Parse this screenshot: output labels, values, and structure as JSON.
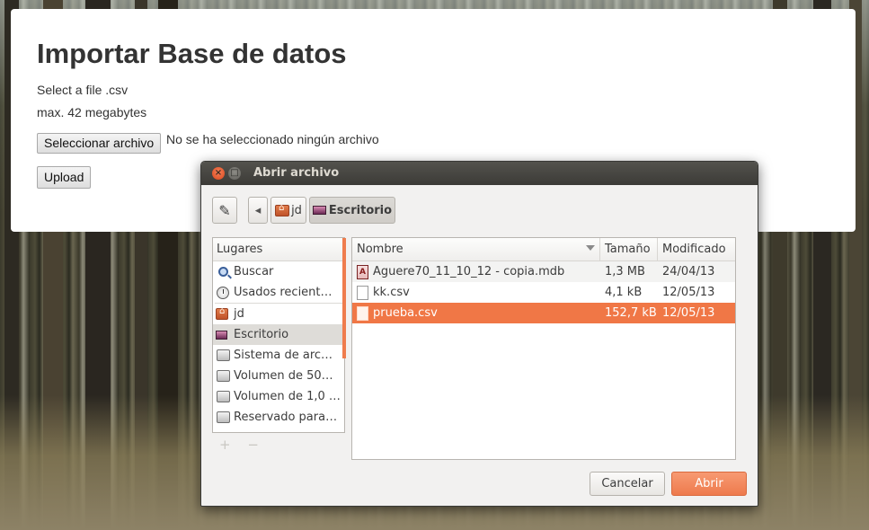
{
  "page": {
    "title": "Importar Base de datos",
    "select_text": "Select a file .csv",
    "max_text": "max. 42 megabytes",
    "choose_file_button": "Seleccionar archivo",
    "no_file_text": "No se ha seleccionado ningún archivo",
    "upload_button": "Upload"
  },
  "dialog": {
    "title": "Abrir archivo",
    "close_symbol": "×",
    "maximize_symbol": "□",
    "edit_icon_glyph": "✎",
    "back_glyph": "◂",
    "breadcrumbs": [
      {
        "label": "jd",
        "icon": "home-folder-icon"
      },
      {
        "label": "Escritorio",
        "icon": "desktop-icon",
        "active": true
      }
    ],
    "places": {
      "header": "Lugares",
      "items": [
        {
          "label": "Buscar",
          "icon": "search-icon"
        },
        {
          "label": "Usados recient…",
          "icon": "recent-icon"
        },
        {
          "label": "jd",
          "icon": "home-folder-icon"
        },
        {
          "label": "Escritorio",
          "icon": "desktop-icon",
          "selected": true
        },
        {
          "label": "Sistema de arc…",
          "icon": "drive-icon"
        },
        {
          "label": "Volumen de 50…",
          "icon": "drive-icon"
        },
        {
          "label": "Volumen de 1,0 …",
          "icon": "drive-icon"
        },
        {
          "label": "Reservado para…",
          "icon": "drive-icon"
        }
      ],
      "add_symbol": "+",
      "remove_symbol": "−"
    },
    "files": {
      "columns": {
        "name": "Nombre",
        "size": "Tamaño",
        "modified": "Modificado"
      },
      "rows": [
        {
          "name": "Aguere70_11_10_12 - copia.mdb",
          "size": "1,3 MB",
          "modified": "24/04/13",
          "icon": "access-db-icon"
        },
        {
          "name": "kk.csv",
          "size": "4,1 kB",
          "modified": "12/05/13",
          "icon": "text-file-icon"
        },
        {
          "name": "prueba.csv",
          "size": "152,7 kB",
          "modified": "12/05/13",
          "icon": "text-file-icon",
          "selected": true
        }
      ]
    },
    "cancel_button": "Cancelar",
    "open_button": "Abrir"
  },
  "colors": {
    "accent": "#f07746",
    "titlebar": "#3c3b37",
    "dialog_bg": "#f2f1f0"
  }
}
